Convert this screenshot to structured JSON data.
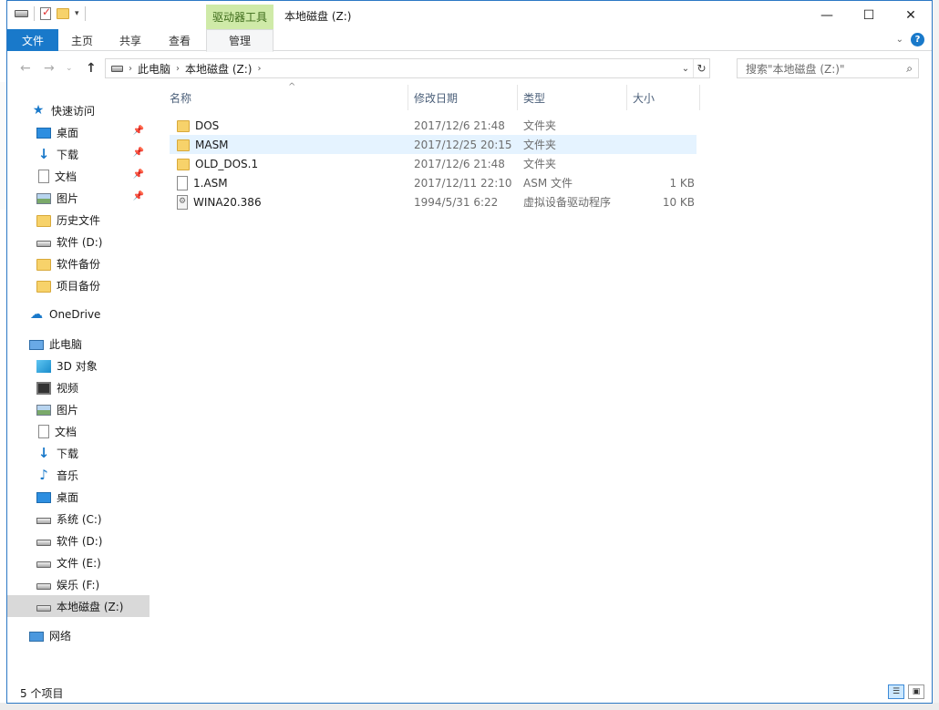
{
  "window": {
    "title": "本地磁盘 (Z:)",
    "context_tab_title": "驱动器工具"
  },
  "ribbon": {
    "tabs": [
      {
        "label": "文件"
      },
      {
        "label": "主页"
      },
      {
        "label": "共享"
      },
      {
        "label": "查看"
      },
      {
        "label": "管理"
      }
    ]
  },
  "address": {
    "crumbs": [
      "此电脑",
      "本地磁盘 (Z:)"
    ],
    "search_placeholder": "搜索\"本地磁盘 (Z:)\""
  },
  "nav": {
    "quick_access": "快速访问",
    "quick_items": [
      {
        "label": "桌面",
        "icon": "desktop-icon",
        "pinned": true
      },
      {
        "label": "下载",
        "icon": "download-icon",
        "pinned": true
      },
      {
        "label": "文档",
        "icon": "document-icon",
        "pinned": true
      },
      {
        "label": "图片",
        "icon": "pictures-icon",
        "pinned": true
      },
      {
        "label": "历史文件",
        "icon": "folder-icon",
        "pinned": false
      },
      {
        "label": "软件 (D:)",
        "icon": "drive-icon",
        "pinned": false
      },
      {
        "label": "软件备份",
        "icon": "folder-icon",
        "pinned": false
      },
      {
        "label": "项目备份",
        "icon": "folder-icon",
        "pinned": false
      }
    ],
    "onedrive": "OneDrive",
    "this_pc": "此电脑",
    "pc_items": [
      {
        "label": "3D 对象",
        "icon": "3d-objects-icon"
      },
      {
        "label": "视频",
        "icon": "video-icon"
      },
      {
        "label": "图片",
        "icon": "pictures-icon"
      },
      {
        "label": "文档",
        "icon": "document-icon"
      },
      {
        "label": "下载",
        "icon": "download-icon"
      },
      {
        "label": "音乐",
        "icon": "music-icon"
      },
      {
        "label": "桌面",
        "icon": "desktop-icon"
      },
      {
        "label": "系统 (C:)",
        "icon": "system-drive-icon"
      },
      {
        "label": "软件 (D:)",
        "icon": "drive-icon"
      },
      {
        "label": "文件 (E:)",
        "icon": "drive-icon"
      },
      {
        "label": "娱乐 (F:)",
        "icon": "drive-icon"
      },
      {
        "label": "本地磁盘 (Z:)",
        "icon": "drive-icon",
        "selected": true
      }
    ],
    "network": "网络"
  },
  "filelist": {
    "columns": [
      "名称",
      "修改日期",
      "类型",
      "大小"
    ],
    "rows": [
      {
        "name": "DOS",
        "date": "2017/12/6 21:48",
        "type": "文件夹",
        "size": "",
        "icon": "folder-icon"
      },
      {
        "name": "MASM",
        "date": "2017/12/25 20:15",
        "type": "文件夹",
        "size": "",
        "icon": "folder-icon",
        "hover": true
      },
      {
        "name": "OLD_DOS.1",
        "date": "2017/12/6 21:48",
        "type": "文件夹",
        "size": "",
        "icon": "folder-icon"
      },
      {
        "name": "1.ASM",
        "date": "2017/12/11 22:10",
        "type": "ASM 文件",
        "size": "1 KB",
        "icon": "file-icon"
      },
      {
        "name": "WINA20.386",
        "date": "1994/5/31 6:22",
        "type": "虚拟设备驱动程序",
        "size": "10 KB",
        "icon": "system-file-icon"
      }
    ]
  },
  "status": {
    "count": "5 个项目"
  },
  "colors": {
    "accent": "#1979ca",
    "context_tab": "#cfeaa8",
    "selection": "#cce8ff"
  }
}
